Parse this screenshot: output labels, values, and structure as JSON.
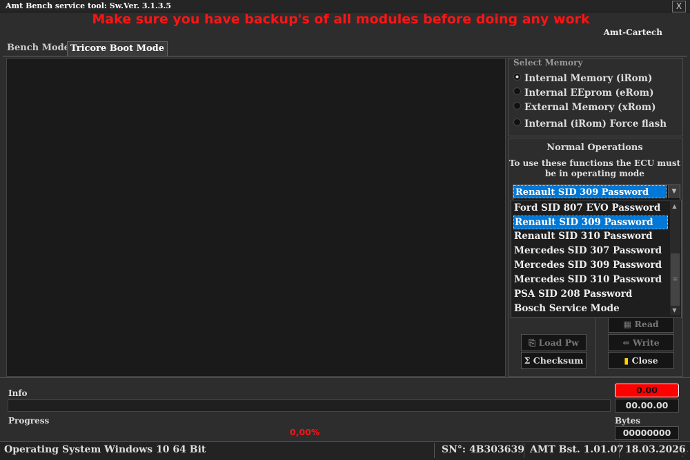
{
  "window": {
    "title": "Amt Bench service tool:  Sw.Ver. 3.1.3.5",
    "close": "X"
  },
  "header": {
    "warning": "Make sure you have backup's of all modules before doing any work",
    "brand": "Amt-Cartech"
  },
  "tabs": [
    {
      "label": "Bench Mode"
    },
    {
      "label": "Tricore Boot Mode"
    }
  ],
  "select_memory": {
    "title": "Select Memory",
    "options": [
      "Internal Memory (iRom)",
      "Internal EEprom (eRom)",
      "External Memory (xRom)",
      "Internal (iRom) Force flash"
    ],
    "selected": "Internal Memory (iRom)"
  },
  "normal_operations": {
    "title": "Normal Operations",
    "subtitle_line1": "To use these functions the ECU must",
    "subtitle_line2": "be in operating mode",
    "combo_value": "Renault SID 309 Password",
    "dropdown": [
      "Ford SID 807 EVO Password",
      "Renault SID 309 Password",
      "Renault SID 310 Password",
      "Mercedes SID 307 Password",
      "Mercedes SID 309 Password",
      "Mercedes SID 310 Password",
      "PSA SID 208 Password",
      "Bosch Service Mode"
    ]
  },
  "buttons": {
    "read": "Read",
    "load_pw": "Load Pw",
    "write": "Write",
    "checksum": "Checksum",
    "close": "Close"
  },
  "info": {
    "label": "Info",
    "red_value": "0.00",
    "time_value": "00.00.00"
  },
  "progress": {
    "label": "Progress",
    "percent_text": "0,00%",
    "percent": 0
  },
  "bytes": {
    "label": "Bytes",
    "value": "00000000"
  },
  "status": {
    "os": "Operating System Windows 10 64 Bit",
    "serial": "SN°: 4B303639",
    "version": "AMT Bst. 1.01.07",
    "date": "18.03.2026"
  }
}
